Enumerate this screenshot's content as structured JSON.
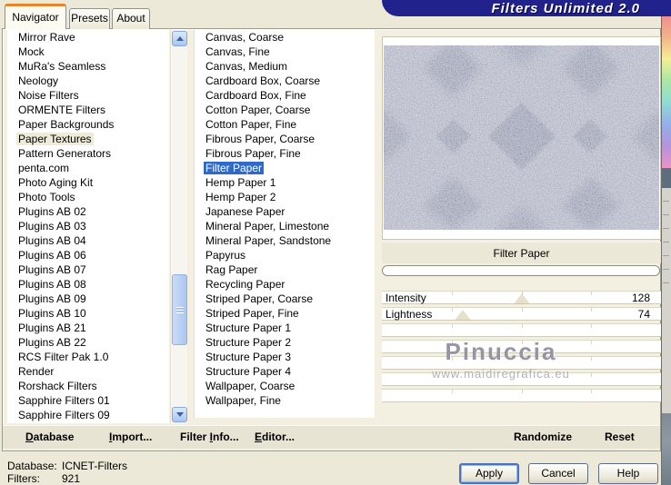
{
  "window": {
    "title": "Filters Unlimited 2.0"
  },
  "tabs": [
    {
      "label": "Navigator",
      "active": true
    },
    {
      "label": "Presets",
      "active": false
    },
    {
      "label": "About",
      "active": false
    }
  ],
  "categories": {
    "selected": "Paper Textures",
    "items": [
      "Mirror Rave",
      "Mock",
      "MuRa's Seamless",
      "Neology",
      "Noise Filters",
      "ORMENTE Filters",
      "Paper Backgrounds",
      "Paper Textures",
      "Pattern Generators",
      "penta.com",
      "Photo Aging Kit",
      "Photo Tools",
      "Plugins AB 02",
      "Plugins AB 03",
      "Plugins AB 04",
      "Plugins AB 06",
      "Plugins AB 07",
      "Plugins AB 08",
      "Plugins AB 09",
      "Plugins AB 10",
      "Plugins AB 21",
      "Plugins AB 22",
      "RCS Filter Pak 1.0",
      "Render",
      "Rorshack Filters",
      "Sapphire Filters 01",
      "Sapphire Filters 09"
    ]
  },
  "filters": {
    "selected": "Filter Paper",
    "items": [
      "Canvas, Coarse",
      "Canvas, Fine",
      "Canvas, Medium",
      "Cardboard Box, Coarse",
      "Cardboard Box, Fine",
      "Cotton Paper, Coarse",
      "Cotton Paper, Fine",
      "Fibrous Paper, Coarse",
      "Fibrous Paper, Fine",
      "Filter Paper",
      "Hemp Paper 1",
      "Hemp Paper 2",
      "Japanese Paper",
      "Mineral Paper, Limestone",
      "Mineral Paper, Sandstone",
      "Papyrus",
      "Rag Paper",
      "Recycling Paper",
      "Striped Paper, Coarse",
      "Striped Paper, Fine",
      "Structure Paper 1",
      "Structure Paper 2",
      "Structure Paper 3",
      "Structure Paper 4",
      "Wallpaper, Coarse",
      "Wallpaper, Fine"
    ]
  },
  "preview": {
    "filter_name": "Filter Paper",
    "watermark_name": "Pinuccia",
    "watermark_url": "www.maidiregrafica.eu"
  },
  "sliders": [
    {
      "label": "Intensity",
      "value": 128,
      "max": 255
    },
    {
      "label": "Lightness",
      "value": 74,
      "max": 255
    }
  ],
  "empty_slider_rows": 5,
  "command_bar": [
    {
      "label": "Database",
      "underline": 0
    },
    {
      "label": "Import...",
      "underline": 0
    },
    {
      "label": "Filter Info...",
      "underline": 7
    },
    {
      "label": "Editor...",
      "underline": 0
    },
    {
      "label": "Randomize",
      "underline": -1
    },
    {
      "label": "Reset",
      "underline": -1
    }
  ],
  "status": {
    "rows": [
      {
        "label": "Database:",
        "value": "ICNET-Filters"
      },
      {
        "label": "Filters:",
        "value": "921"
      }
    ]
  },
  "action_buttons": [
    {
      "label": "Apply",
      "default": true
    },
    {
      "label": "Cancel",
      "default": false
    },
    {
      "label": "Help",
      "default": false
    }
  ],
  "colors": {
    "banner": "#22228c",
    "selection_blue": "#316ac5",
    "selection_cream": "#eeebd8",
    "dialog_bg": "#ece9d8",
    "tab_accent_orange": "#e5862c"
  }
}
